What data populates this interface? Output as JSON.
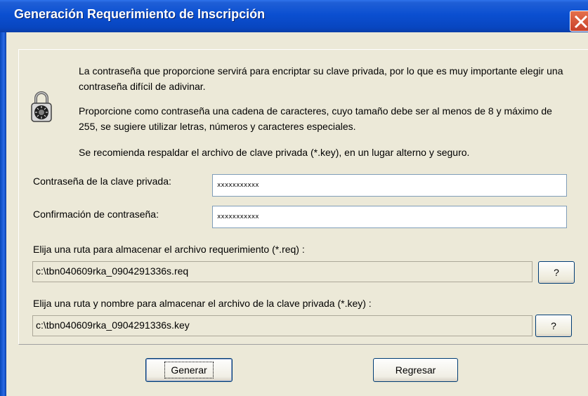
{
  "window": {
    "title": "Generación Requerimiento de Inscripción",
    "close_icon": "close-icon"
  },
  "info": {
    "icon": "padlock-icon",
    "paragraph1": "La contraseña que proporcione servirá para encriptar su clave privada, por lo que es muy importante elegir una contraseña difícil de adivinar.",
    "paragraph2": "Proporcione como contraseña una cadena de caracteres, cuyo tamaño debe ser al menos de 8 y máximo de 255, se sugiere utilizar letras, números y caracteres especiales.",
    "paragraph3": "Se recomienda respaldar el archivo de clave privada (*.key), en un lugar alterno y seguro."
  },
  "form": {
    "password_label": "Contraseña de la clave privada:",
    "password_value": "xxxxxxxxxxx",
    "confirm_label": "Confirmación de contraseña:",
    "confirm_value": "xxxxxxxxxxx",
    "req_label": "Elija una ruta para almacenar el archivo requerimiento (*.req) :",
    "req_path": "c:\\tbn040609rka_0904291336s.req",
    "req_browse": "?",
    "key_label": "Elija una ruta y nombre para almacenar el archivo de la clave privada (*.key) :",
    "key_path": "c:\\tbn040609rka_0904291336s.key",
    "key_browse": "?"
  },
  "buttons": {
    "generate": "Generar",
    "back": "Regresar"
  }
}
